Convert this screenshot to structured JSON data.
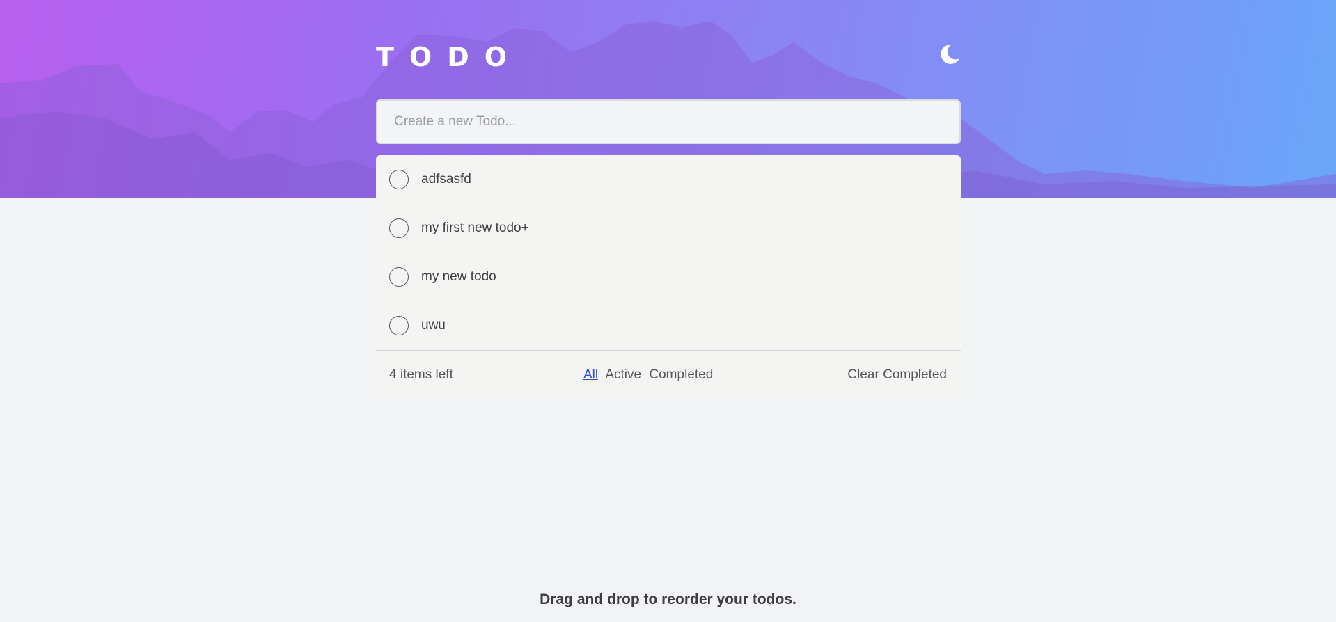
{
  "header": {
    "title": "TODO",
    "theme_toggle_icon": "moon-icon"
  },
  "new_todo": {
    "placeholder": "Create a new Todo..."
  },
  "todos": [
    {
      "text": "adfsasfd",
      "completed": false
    },
    {
      "text": "my first new todo+",
      "completed": false
    },
    {
      "text": "my new todo",
      "completed": false
    },
    {
      "text": "uwu",
      "completed": false
    }
  ],
  "footer": {
    "items_left": "4 items left",
    "filters": {
      "all": "All",
      "active": "Active",
      "completed": "Completed",
      "selected": "All"
    },
    "clear_completed": "Clear Completed"
  },
  "hint": "Drag and drop to reorder your todos.",
  "colors": {
    "accent_link": "#2e50c7",
    "gradient_start": "#b85ff0",
    "gradient_end": "#6aa6f8",
    "page_background": "#f2f3f5"
  }
}
